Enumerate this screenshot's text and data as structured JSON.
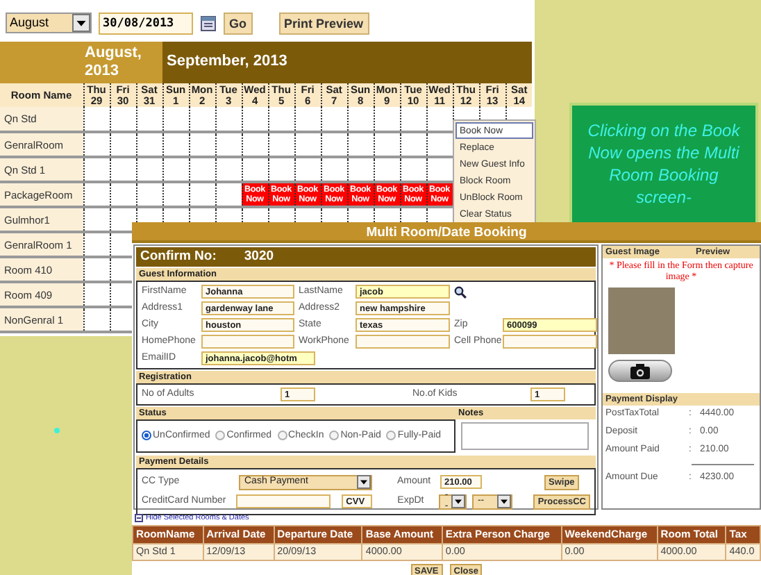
{
  "toolbar": {
    "month": "August",
    "date": "30/08/2013",
    "go": "Go",
    "print_preview": "Print Preview"
  },
  "calendar": {
    "room_header": "Room Name",
    "months": [
      {
        "label": "August, 2013",
        "days": [
          {
            "weekday": "Thu",
            "day": "29"
          },
          {
            "weekday": "Fri",
            "day": "30"
          },
          {
            "weekday": "Sat",
            "day": "31"
          }
        ]
      },
      {
        "label": "September, 2013",
        "days": [
          {
            "weekday": "Sun",
            "day": "1"
          },
          {
            "weekday": "Mon",
            "day": "2"
          },
          {
            "weekday": "Tue",
            "day": "3"
          },
          {
            "weekday": "Wed",
            "day": "4"
          },
          {
            "weekday": "Thu",
            "day": "5"
          },
          {
            "weekday": "Fri",
            "day": "6"
          },
          {
            "weekday": "Sat",
            "day": "7"
          },
          {
            "weekday": "Sun",
            "day": "8"
          },
          {
            "weekday": "Mon",
            "day": "9"
          },
          {
            "weekday": "Tue",
            "day": "10"
          },
          {
            "weekday": "Wed",
            "day": "11"
          },
          {
            "weekday": "Thu",
            "day": "12"
          },
          {
            "weekday": "Fri",
            "day": "13"
          },
          {
            "weekday": "Sat",
            "day": "14"
          }
        ]
      }
    ],
    "rooms": [
      {
        "name": "Qn Std"
      },
      {
        "name": "GenralRoom"
      },
      {
        "name": "Qn Std 1"
      },
      {
        "name": "PackageRoom",
        "cells": [
          {
            "booked": false
          },
          {
            "booked": false
          },
          {
            "booked": false
          },
          {
            "booked": false
          },
          {
            "booked": false
          },
          {
            "booked": false
          },
          {
            "booked": true,
            "text": "Book Now"
          },
          {
            "booked": true,
            "text": "Book Now"
          },
          {
            "booked": true,
            "text": "Book Now"
          },
          {
            "booked": true,
            "text": "Book Now"
          },
          {
            "booked": true,
            "text": "Book Now"
          },
          {
            "booked": true,
            "text": "Book Now"
          },
          {
            "booked": true,
            "text": "Book Now"
          },
          {
            "booked": true,
            "text": "Book Now"
          }
        ]
      },
      {
        "name": "Gulmhor1"
      },
      {
        "name": "GenralRoom 1"
      },
      {
        "name": "Room 410"
      },
      {
        "name": "Room 409"
      },
      {
        "name": "NonGenral 1"
      }
    ]
  },
  "context_menu": [
    {
      "label": "Book Now",
      "selected": true
    },
    {
      "label": "Replace",
      "selected": false
    },
    {
      "label": "New Guest Info",
      "selected": false
    },
    {
      "label": "Block Room",
      "selected": false
    },
    {
      "label": "UnBlock Room",
      "selected": false
    },
    {
      "label": "Clear Status",
      "selected": false
    }
  ],
  "note": "Clicking on the Book Now opens the Multi Room Booking screen-",
  "dialog": {
    "title": "Multi Room/Date Booking",
    "confirm_label": "Confirm No:",
    "confirm_number": "3020",
    "guest_information": {
      "title": "Guest Information",
      "rows": [
        [
          {
            "label": "FirstName",
            "value": "Johanna",
            "highlighted": false
          },
          {
            "label": "LastName",
            "value": "jacob",
            "highlighted": true
          }
        ],
        [
          {
            "label": "Address1",
            "value": "gardenway lane",
            "highlighted": false
          },
          {
            "label": "Address2",
            "value": "new hampshire",
            "highlighted": false
          }
        ],
        [
          {
            "label": "City",
            "value": "houston",
            "highlighted": false
          },
          {
            "label": "State",
            "value": "texas",
            "highlighted": false
          },
          {
            "label": "Zip",
            "value": "600099",
            "highlighted": true
          }
        ],
        [
          {
            "label": "HomePhone",
            "highlighted": false
          },
          {
            "label": "WorkPhone",
            "highlighted": false
          },
          {
            "label": "Cell Phone",
            "highlighted": false
          }
        ],
        [
          {
            "label": "EmailID",
            "value": "johanna.jacob@hotm",
            "highlighted": true
          }
        ]
      ]
    },
    "registration": {
      "title": "Registration",
      "fields": [
        {
          "label": "No of Adults",
          "value": "1"
        },
        {
          "label": "No.of Kids",
          "value": "1"
        }
      ]
    },
    "status": {
      "title": "Status",
      "options": [
        {
          "label": "UnConfirmed",
          "selected": true
        },
        {
          "label": "Confirmed",
          "selected": false
        },
        {
          "label": "CheckIn",
          "selected": false
        },
        {
          "label": "Non-Paid",
          "selected": false
        },
        {
          "label": "Fully-Paid",
          "selected": false
        }
      ]
    },
    "notes": {
      "title": "Notes"
    },
    "payment": {
      "title": "Payment Details",
      "cc_type": {
        "label": "CC Type",
        "value": "Cash Payment"
      },
      "amount": {
        "label": "Amount",
        "value": "210.00"
      },
      "swipe": "Swipe",
      "card_number": {
        "label": "CreditCard Number"
      },
      "cvv": {
        "value": "CVV"
      },
      "exp_date": {
        "label": "ExpDt",
        "month": "--",
        "year": "--"
      },
      "process": "ProcessCC"
    },
    "guest_image": {
      "header_left": "Guest Image",
      "header_right": "Preview",
      "note": "* Please fill in the Form then capture image *"
    },
    "payment_display": {
      "title": "Payment Display",
      "rows": [
        {
          "label": "PostTaxTotal",
          "separator": ":",
          "value": "4440.00",
          "kind": "line"
        },
        {
          "label": "Deposit",
          "separator": ":",
          "value": "0.00",
          "kind": "line"
        },
        {
          "label": "Amount Paid",
          "separator": ":",
          "value": "210.00",
          "kind": "line"
        },
        {
          "label": "Amount Due",
          "separator": ":",
          "value": "4230.00",
          "kind": "total"
        }
      ]
    },
    "hide_link": "Hide Selected Rooms & Dates",
    "table": {
      "columns": [
        "RoomName",
        "Arrival Date",
        "Departure Date",
        "Base Amount",
        "Extra Person Charge",
        "WeekendCharge",
        "Room Total",
        "Tax"
      ],
      "rows": [
        [
          "Qn Std 1",
          "12/09/13",
          "20/09/13",
          "4000.00",
          "0.00",
          "0.00",
          "4000.00",
          "440.0"
        ]
      ]
    },
    "buttons": [
      "SAVE",
      "Close"
    ]
  }
}
